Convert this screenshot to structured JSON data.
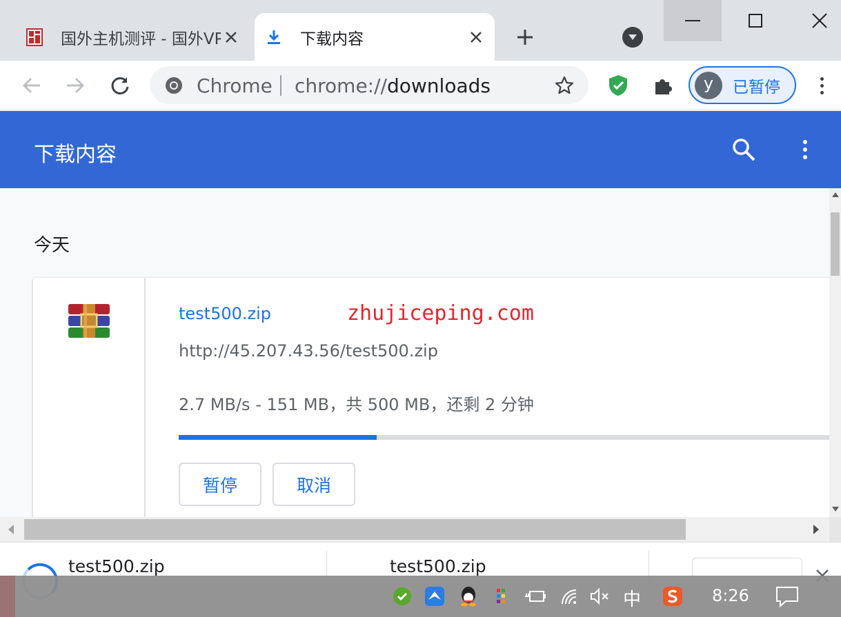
{
  "tabs": [
    {
      "title": "国外主机测评 - 国外VPS，国",
      "favicon": "site-favicon-icon",
      "active": false
    },
    {
      "title": "下载内容",
      "favicon": "download-icon",
      "active": true
    }
  ],
  "omnibox": {
    "chip": "Chrome",
    "scheme": "chrome://",
    "host": "downloads"
  },
  "profile": {
    "initial": "y",
    "label": "已暂停"
  },
  "page": {
    "title": "下载内容"
  },
  "downloads": {
    "section": "今天",
    "item": {
      "name": "test500.zip",
      "url": "http://45.207.43.56/test500.zip",
      "status": "2.7 MB/s - 151 MB，共 500 MB，还剩 2 分钟",
      "progress": 0.302,
      "pause_label": "暂停",
      "cancel_label": "取消",
      "watermark": "zhujiceping.com"
    }
  },
  "shelf": {
    "items": [
      "test500.zip",
      "test500.zip"
    ]
  },
  "taskbar": {
    "ime": "中",
    "time": "8:26"
  },
  "colors": {
    "accent": "#1a73e8",
    "header": "#3367d6",
    "watermark": "#e8242b"
  }
}
